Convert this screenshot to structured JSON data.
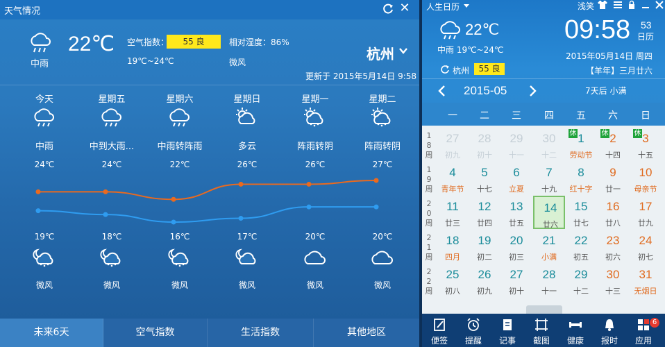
{
  "weather": {
    "title": "天气情况",
    "current": {
      "temp": "22℃",
      "condition": "中雨",
      "aqi_label": "空气指数：",
      "aqi_value": "55 良",
      "humidity": "相对湿度：86%",
      "range": "19℃~24℃",
      "wind": "微风"
    },
    "city": "杭州",
    "updated": "更新于 2015年5月14日  9:58",
    "days": [
      {
        "name": "今天",
        "condition": "中雨",
        "high": "24℃",
        "low": "19℃",
        "wind": "微风",
        "icon_day": "rain-cloud-icon",
        "icon_night": "night-rain-icon"
      },
      {
        "name": "星期五",
        "condition": "中到大雨...",
        "high": "24℃",
        "low": "18℃",
        "wind": "微风",
        "icon_day": "rain-cloud-icon",
        "icon_night": "night-rain-icon"
      },
      {
        "name": "星期六",
        "condition": "中雨转阵雨",
        "high": "22℃",
        "low": "16℃",
        "wind": "微风",
        "icon_day": "rain-cloud-icon",
        "icon_night": "night-rain-icon"
      },
      {
        "name": "星期日",
        "condition": "多云",
        "high": "26℃",
        "low": "17℃",
        "wind": "微风",
        "icon_day": "sun-cloud-icon",
        "icon_night": "night-cloud-icon"
      },
      {
        "name": "星期一",
        "condition": "阵雨转阴",
        "high": "26℃",
        "low": "20℃",
        "wind": "微风",
        "icon_day": "sun-rain-icon",
        "icon_night": "cloud-icon"
      },
      {
        "name": "星期二",
        "condition": "阵雨转阴",
        "high": "27℃",
        "low": "20℃",
        "wind": "微风",
        "icon_day": "sun-rain-icon",
        "icon_night": "cloud-icon"
      }
    ],
    "highs": [
      24,
      24,
      22,
      26,
      26,
      27
    ],
    "lows": [
      19,
      18,
      16,
      17,
      20,
      20
    ],
    "tabs": [
      "未来6天",
      "空气指数",
      "生活指数",
      "其他地区"
    ],
    "colors": {
      "high": "#ea6a1f",
      "low": "#2f9cf0",
      "aqi": "#ffe81b"
    }
  },
  "calendar": {
    "title": "人生日历",
    "weather_label": "浅笑",
    "temp": "22℃",
    "condition": "中雨 19℃~24℃",
    "city": "杭州",
    "aqi": "55 良",
    "time": "09:58",
    "seconds": "53",
    "day_label": "日历",
    "date": "2015年05月14日 周四",
    "lunar": "【羊年】三月廿六",
    "month": "2015-05",
    "solar_term": "7天后 小满",
    "weekdays": [
      "一",
      "二",
      "三",
      "四",
      "五",
      "六",
      "日"
    ],
    "weeknums": [
      [
        "1",
        "8",
        "周"
      ],
      [
        "1",
        "9",
        "周"
      ],
      [
        "2",
        "0",
        "周"
      ],
      [
        "2",
        "1",
        "周"
      ],
      [
        "2",
        "2",
        "周"
      ]
    ],
    "rows": [
      [
        {
          "n": "27",
          "l": "初九",
          "other": true
        },
        {
          "n": "28",
          "l": "初十",
          "other": true
        },
        {
          "n": "29",
          "l": "十一",
          "other": true
        },
        {
          "n": "30",
          "l": "十二",
          "other": true
        },
        {
          "n": "1",
          "l": "劳动节",
          "hol": "休",
          "color": "#1a8c9a",
          "lcolor": "#e06b1f"
        },
        {
          "n": "2",
          "l": "十四",
          "hol": "休",
          "color": "#e06b1f"
        },
        {
          "n": "3",
          "l": "十五",
          "hol": "休",
          "color": "#e06b1f"
        }
      ],
      [
        {
          "n": "4",
          "l": "青年节",
          "lcolor": "#e06b1f"
        },
        {
          "n": "5",
          "l": "十七"
        },
        {
          "n": "6",
          "l": "立夏",
          "lcolor": "#e06b1f"
        },
        {
          "n": "7",
          "l": "十九"
        },
        {
          "n": "8",
          "l": "红十字",
          "lcolor": "#e06b1f"
        },
        {
          "n": "9",
          "l": "廿一",
          "color": "#e06b1f"
        },
        {
          "n": "10",
          "l": "母亲节",
          "color": "#e06b1f",
          "lcolor": "#e06b1f"
        }
      ],
      [
        {
          "n": "11",
          "l": "廿三"
        },
        {
          "n": "12",
          "l": "廿四"
        },
        {
          "n": "13",
          "l": "廿五"
        },
        {
          "n": "14",
          "l": "廿六",
          "today": true
        },
        {
          "n": "15",
          "l": "廿七"
        },
        {
          "n": "16",
          "l": "廿八",
          "color": "#e06b1f"
        },
        {
          "n": "17",
          "l": "廿九",
          "color": "#e06b1f"
        }
      ],
      [
        {
          "n": "18",
          "l": "四月",
          "lcolor": "#e06b1f"
        },
        {
          "n": "19",
          "l": "初二"
        },
        {
          "n": "20",
          "l": "初三"
        },
        {
          "n": "21",
          "l": "小满",
          "lcolor": "#e06b1f"
        },
        {
          "n": "22",
          "l": "初五"
        },
        {
          "n": "23",
          "l": "初六",
          "color": "#e06b1f"
        },
        {
          "n": "24",
          "l": "初七",
          "color": "#e06b1f"
        }
      ],
      [
        {
          "n": "25",
          "l": "初八"
        },
        {
          "n": "26",
          "l": "初九"
        },
        {
          "n": "27",
          "l": "初十"
        },
        {
          "n": "28",
          "l": "十一"
        },
        {
          "n": "29",
          "l": "十二"
        },
        {
          "n": "30",
          "l": "十三",
          "color": "#e06b1f"
        },
        {
          "n": "31",
          "l": "无烟日",
          "color": "#e06b1f",
          "lcolor": "#e06b1f"
        }
      ]
    ],
    "toolbar": [
      {
        "label": "便签",
        "icon": "note-icon"
      },
      {
        "label": "提醒",
        "icon": "alarm-icon"
      },
      {
        "label": "记事",
        "icon": "notebook-icon"
      },
      {
        "label": "截图",
        "icon": "screenshot-icon"
      },
      {
        "label": "健康",
        "icon": "dumbbell-icon"
      },
      {
        "label": "报时",
        "icon": "bell-icon"
      },
      {
        "label": "应用",
        "icon": "apps-icon"
      }
    ],
    "app_badge": "6",
    "number_color": "#1a8c9a"
  }
}
